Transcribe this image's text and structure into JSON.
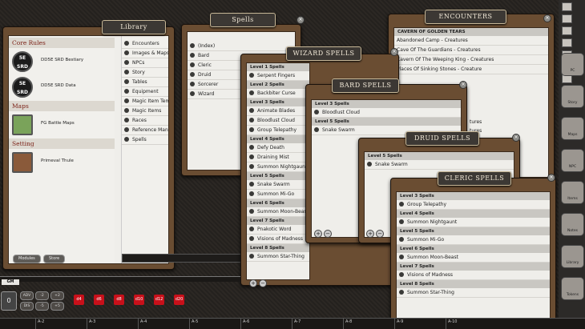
{
  "library": {
    "title": "Library",
    "categories": [
      {
        "name": "Core Rules",
        "modules": [
          {
            "logo_line1": "5E",
            "logo_line2": "SRD",
            "label": "DD5E SRD Bestiary"
          },
          {
            "logo_line1": "5E",
            "logo_line2": "SRD",
            "label": "DD5E SRD Data"
          }
        ]
      },
      {
        "name": "Maps",
        "modules": [
          {
            "label": "FG Battle Maps"
          }
        ]
      },
      {
        "name": "Setting",
        "modules": [
          {
            "label": "Primeval Thule"
          }
        ]
      }
    ],
    "links": [
      "Encounters",
      "Images & Maps",
      "NPCs",
      "Story",
      "Tables",
      "Equipment",
      "Magic Item Templates",
      "Magic Items",
      "Races",
      "Reference Manual",
      "Spells"
    ],
    "btn_modules": "Modules",
    "btn_store": "Store"
  },
  "spells": {
    "title": "Spells",
    "items": [
      "(Index)",
      "Bard",
      "Cleric",
      "Druid",
      "Sorcerer",
      "Wizard"
    ]
  },
  "wizard": {
    "title": "Wizard Spells",
    "groups": [
      {
        "level": "Level 1 Spells",
        "items": [
          "Serpent Fingers"
        ]
      },
      {
        "level": "Level 2 Spells",
        "items": [
          "Backbiter Curse"
        ]
      },
      {
        "level": "Level 3 Spells",
        "items": [
          "Animate Blades",
          "Bloodlust Cloud",
          "Group Telepathy"
        ]
      },
      {
        "level": "Level 4 Spells",
        "items": [
          "Defy Death",
          "Draining Mist",
          "Summon Nightgaunt"
        ]
      },
      {
        "level": "Level 5 Spells",
        "items": [
          "Snake Swarm",
          "Summon Mi-Go"
        ]
      },
      {
        "level": "Level 6 Spells",
        "items": [
          "Summon Moon-Beast"
        ]
      },
      {
        "level": "Level 7 Spells",
        "items": [
          "Pnakotic Word",
          "Visions of Madness"
        ]
      },
      {
        "level": "Level 8 Spells",
        "items": [
          "Summon Star-Thing"
        ]
      }
    ]
  },
  "bard": {
    "title": "Bard Spells",
    "groups": [
      {
        "level": "Level 3 Spells",
        "items": [
          "Bloodlust Cloud"
        ]
      },
      {
        "level": "Level 5 Spells",
        "items": [
          "Snake Swarm"
        ]
      }
    ]
  },
  "druid": {
    "title": "Druid Spells",
    "groups": [
      {
        "level": "Level 5 Spells",
        "items": [
          "Snake Swarm"
        ]
      }
    ]
  },
  "cleric": {
    "title": "Cleric Spells",
    "groups": [
      {
        "level": "Level 3 Spells",
        "items": [
          "Group Telepathy"
        ]
      },
      {
        "level": "Level 4 Spells",
        "items": [
          "Summon Nightgaunt"
        ]
      },
      {
        "level": "Level 5 Spells",
        "items": [
          "Summon Mi-Go"
        ]
      },
      {
        "level": "Level 6 Spells",
        "items": [
          "Summon Moon-Beast"
        ]
      },
      {
        "level": "Level 7 Spells",
        "items": [
          "Visions of Madness"
        ]
      },
      {
        "level": "Level 8 Spells",
        "items": [
          "Summon Star-Thing"
        ]
      }
    ]
  },
  "encounters": {
    "title": "Encounters",
    "group": "Cavern of Golden Tears",
    "items": [
      "Abandoned Camp - Creatures",
      "Cave Of The Guardians - Creatures",
      "Cavern Of The Weeping King - Creatures",
      "Places Of Sinking Stones - Creature"
    ],
    "partial": [
      "tures",
      "tures",
      "ures"
    ]
  },
  "sidebar": [
    "PC",
    "Story",
    "Maps",
    "NPC",
    "Items",
    "Notes",
    "Library",
    "Tokens"
  ],
  "chat": {
    "gm_label": "GM",
    "modifier": "0"
  },
  "modifier_buttons": [
    "ADV",
    "-2",
    "+2",
    "DIS",
    "-5",
    "+5"
  ],
  "dice": [
    "d4",
    "d6",
    "d8",
    "d10",
    "d12",
    "d20"
  ],
  "hotkeys": [
    "A-2",
    "A-3",
    "A-4",
    "A-5",
    "A-6",
    "A-7",
    "A-8",
    "A-9",
    "A-10"
  ],
  "colors": {
    "accent": "#7a1f14",
    "frame": "#6a4d32",
    "panel": "#efeeea",
    "dice": "#c8101a"
  }
}
